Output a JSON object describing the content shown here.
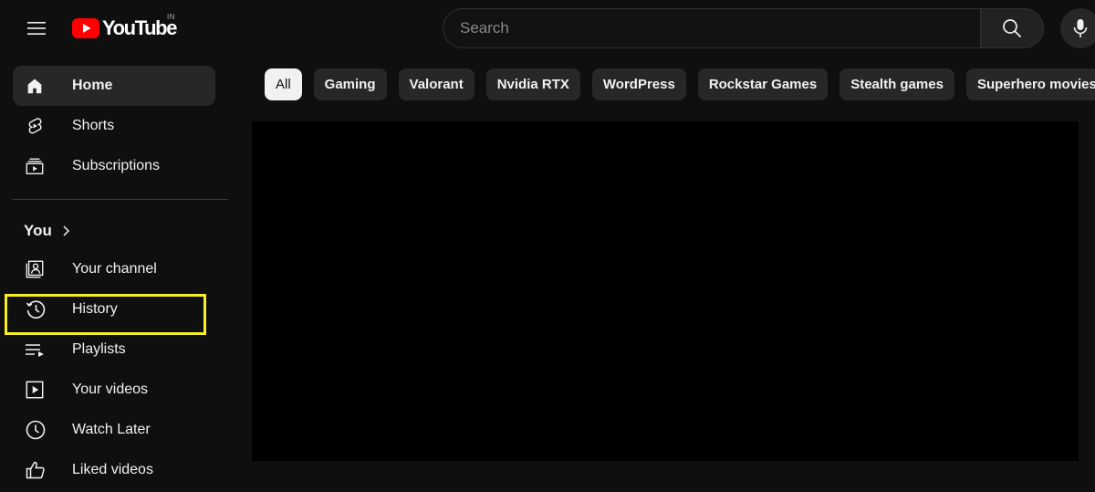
{
  "header": {
    "logo_text": "YouTube",
    "region_code": "IN",
    "search_placeholder": "Search"
  },
  "sidebar": {
    "primary": [
      {
        "label": "Home",
        "icon": "home-icon",
        "active": true
      },
      {
        "label": "Shorts",
        "icon": "shorts-icon"
      },
      {
        "label": "Subscriptions",
        "icon": "subscriptions-icon"
      }
    ],
    "you_section": {
      "title": "You",
      "items": [
        {
          "label": "Your channel",
          "icon": "your-channel-icon"
        },
        {
          "label": "History",
          "icon": "history-icon",
          "highlighted": true
        },
        {
          "label": "Playlists",
          "icon": "playlists-icon"
        },
        {
          "label": "Your videos",
          "icon": "your-videos-icon"
        },
        {
          "label": "Watch Later",
          "icon": "watch-later-icon"
        },
        {
          "label": "Liked videos",
          "icon": "liked-videos-icon"
        }
      ]
    }
  },
  "chips": [
    "All",
    "Gaming",
    "Valorant",
    "Nvidia RTX",
    "WordPress",
    "Rockstar Games",
    "Stealth games",
    "Superhero movies"
  ],
  "colors": {
    "background": "#0f0f0f",
    "brand_red": "#ff0000",
    "highlight_box": "#f6ef22",
    "chip_bg": "#272727",
    "chip_selected_bg": "#f1f1f1"
  }
}
